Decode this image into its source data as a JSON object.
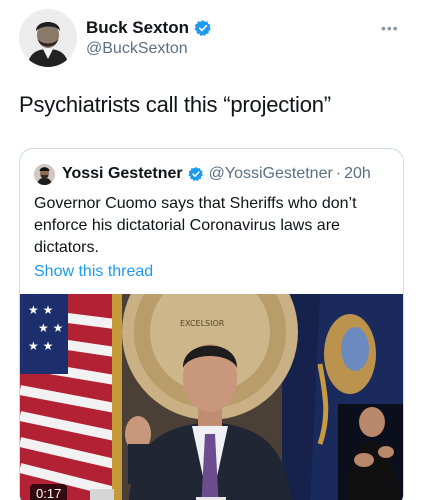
{
  "author": {
    "display_name": "Buck Sexton",
    "handle": "@BuckSexton",
    "verified": true
  },
  "tweet": {
    "text": "Psychiatrists call this “projection”"
  },
  "more_icon": "more-horizontal-icon",
  "quoted_tweet": {
    "display_name": "Yossi Gestetner",
    "handle": "@YossiGestetner",
    "separator": "·",
    "time": "20h",
    "verified": true,
    "text": "Governor Cuomo says that Sheriffs who don’t enforce his dictatorial Coronavirus laws are dictators.",
    "show_thread": "Show this thread",
    "video": {
      "duration": "0:17",
      "seal_text": "EXCELSIOR"
    }
  },
  "colors": {
    "link_blue": "#1d9bf0",
    "verified_blue": "#1d9bf0",
    "secondary_text": "#5b7083",
    "border": "#cfd9de"
  }
}
